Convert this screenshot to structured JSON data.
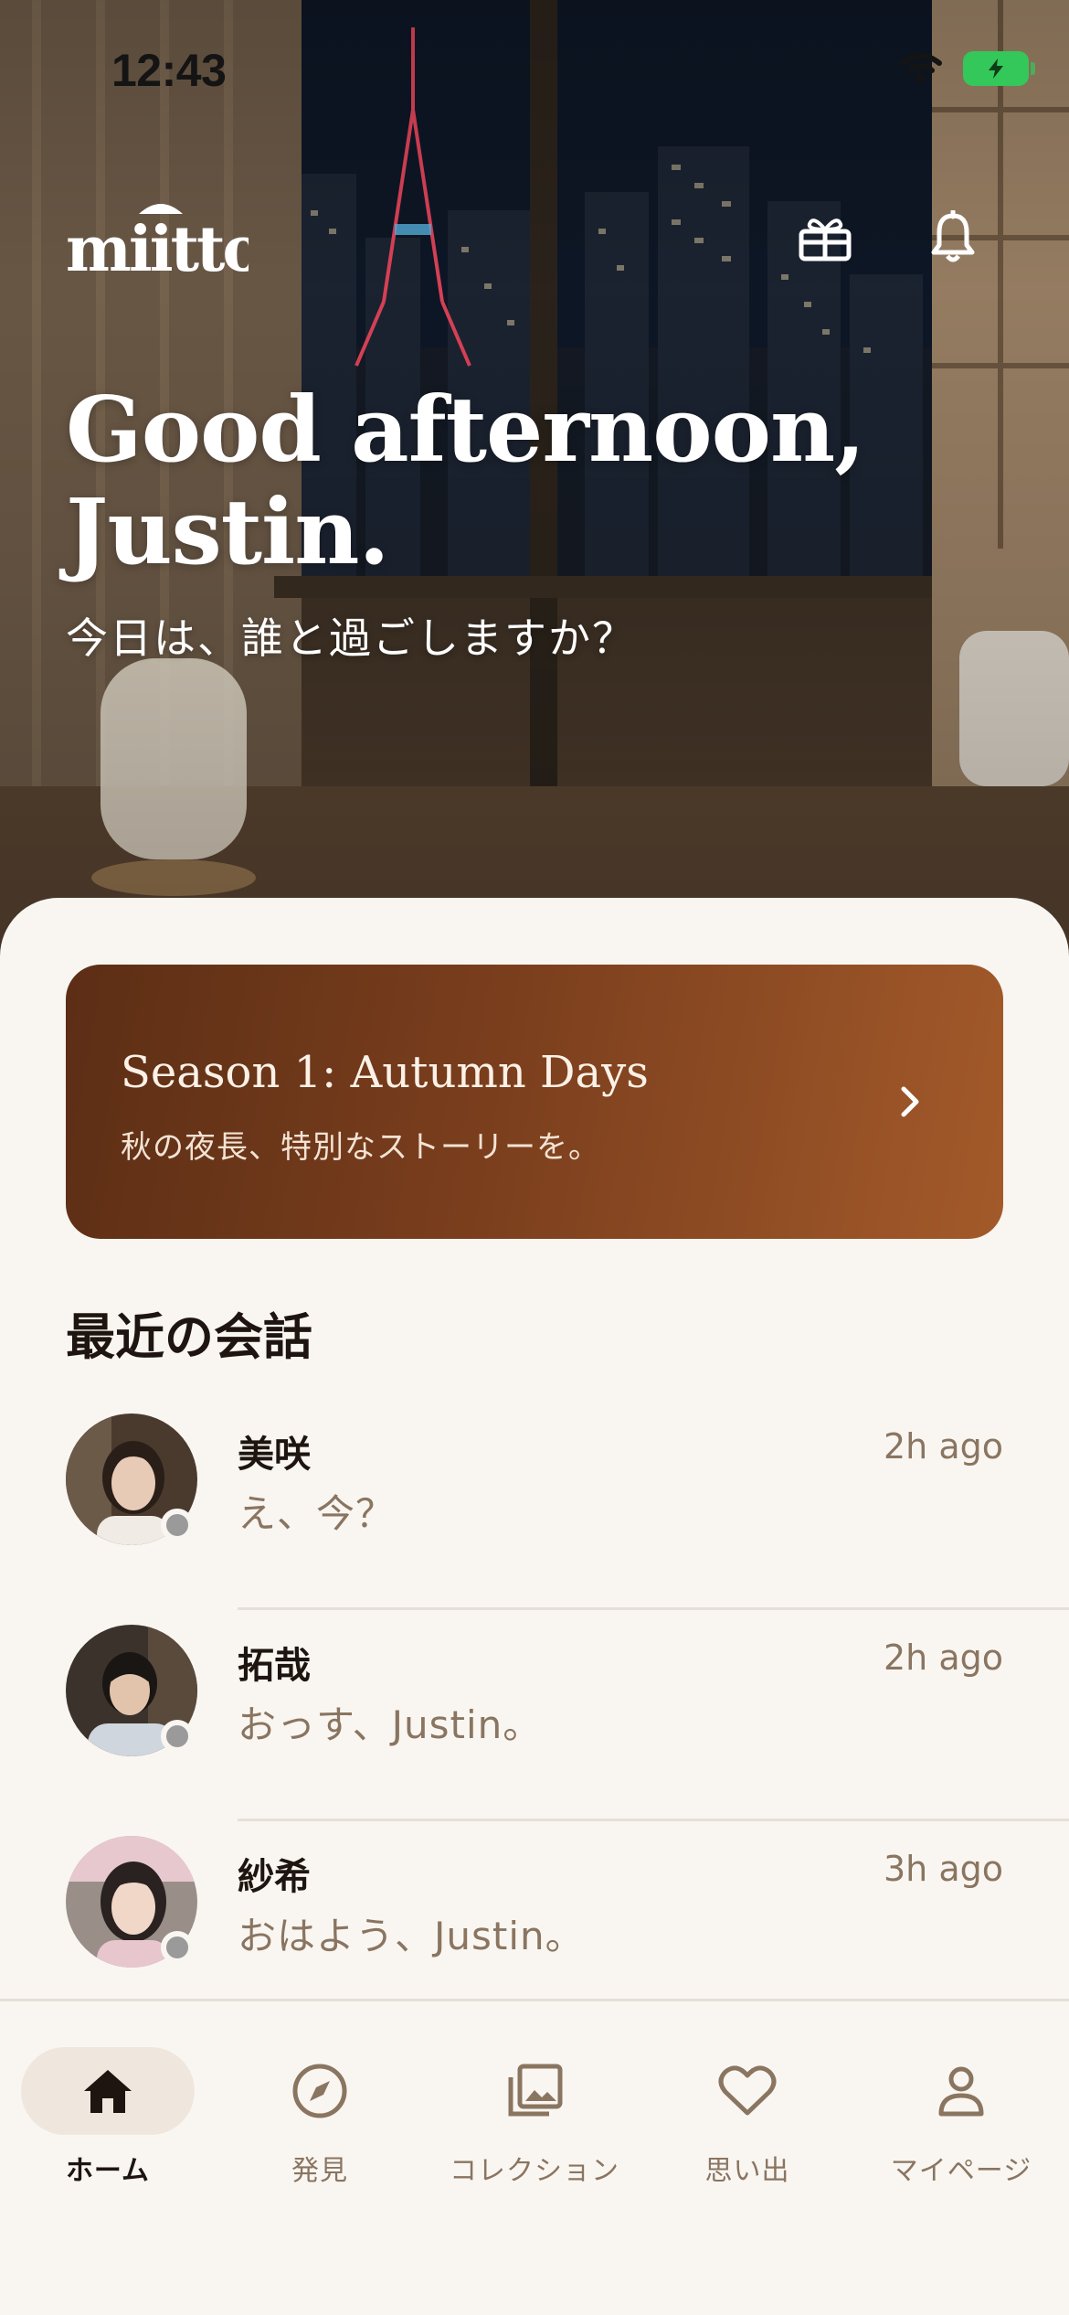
{
  "status_bar": {
    "time": "12:43"
  },
  "header": {
    "logo_text": "miitto",
    "greeting": "Good afternoon, Justin.",
    "subtitle": "今日は、誰と過ごしますか？"
  },
  "banner": {
    "title": "Season 1: Autumn Days",
    "subtitle": "秋の夜長、特別なストーリーを。"
  },
  "recent": {
    "title": "最近の会話",
    "conversations": [
      {
        "name": "美咲",
        "message": "え、今？",
        "time": "2h ago"
      },
      {
        "name": "拓哉",
        "message": "おっす、Justin。",
        "time": "2h ago"
      },
      {
        "name": "紗希",
        "message": "おはよう、Justin。",
        "time": "3h ago"
      }
    ]
  },
  "tabs": [
    {
      "label": "ホーム",
      "icon": "home-icon",
      "active": true
    },
    {
      "label": "発見",
      "icon": "compass-icon"
    },
    {
      "label": "コレクション",
      "icon": "gallery-icon"
    },
    {
      "label": "思い出",
      "icon": "heart-icon"
    },
    {
      "label": "マイページ",
      "icon": "person-icon"
    }
  ],
  "colors": {
    "background": "#f9f6f2",
    "banner_start": "#5c2e15",
    "banner_end": "#a35a2a",
    "muted_text": "#8a7560",
    "battery": "#34c759"
  }
}
